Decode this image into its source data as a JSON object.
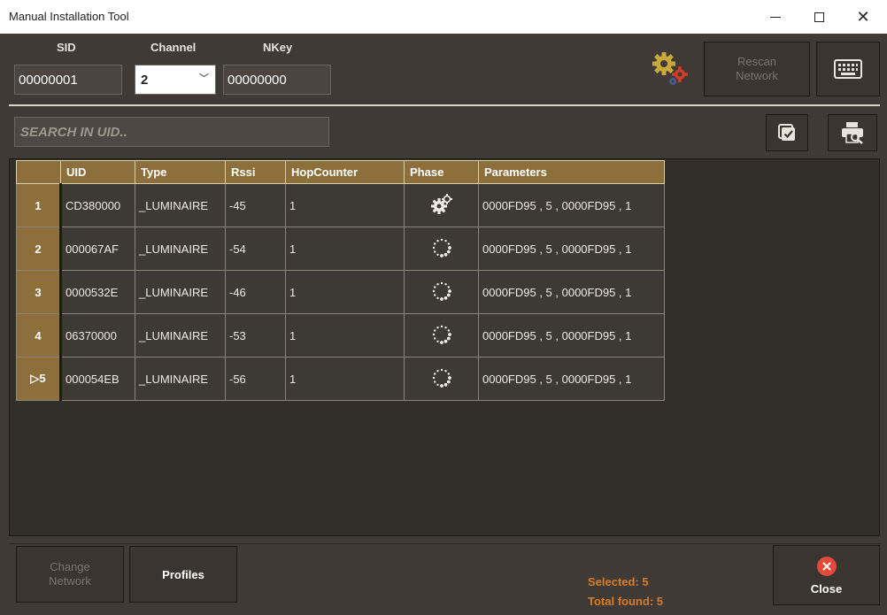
{
  "window": {
    "title": "Manual Installation Tool",
    "minimize_glyph": "",
    "maximize_glyph": "",
    "close_glyph": "✕"
  },
  "header": {
    "sid_label": "SID",
    "sid_value": "00000001",
    "channel_label": "Channel",
    "channel_value": "2",
    "nkey_label": "NKey",
    "nkey_value": "00000000",
    "rescan_line1": "Rescan",
    "rescan_line2": "Network"
  },
  "search": {
    "placeholder": "SEARCH IN UID.."
  },
  "table": {
    "columns": [
      "UID",
      "Type",
      "Rssi",
      "HopCounter",
      "Phase",
      "Parameters"
    ],
    "rows": [
      {
        "num": "1",
        "uid": "CD380000",
        "type": "_LUMINAIRE",
        "rssi": "-45",
        "hop": "1",
        "phase": "gears-icon",
        "params": "0000FD95 , 5 , 0000FD95 , 1"
      },
      {
        "num": "2",
        "uid": "000067AF",
        "type": "_LUMINAIRE",
        "rssi": "-54",
        "hop": "1",
        "phase": "loading-dots-icon",
        "params": "0000FD95 , 5 , 0000FD95 , 1"
      },
      {
        "num": "3",
        "uid": "0000532E",
        "type": "_LUMINAIRE",
        "rssi": "-46",
        "hop": "1",
        "phase": "loading-dots-icon",
        "params": "0000FD95 , 5 , 0000FD95 , 1"
      },
      {
        "num": "4",
        "uid": "06370000",
        "type": "_LUMINAIRE",
        "rssi": "-53",
        "hop": "1",
        "phase": "loading-dots-icon",
        "params": "0000FD95 , 5 , 0000FD95 , 1"
      },
      {
        "num": "▷5",
        "uid": "000054EB",
        "type": "_LUMINAIRE",
        "rssi": "-56",
        "hop": "1",
        "phase": "loading-dots-icon",
        "params": "0000FD95 , 5 , 0000FD95 , 1"
      }
    ]
  },
  "footer": {
    "change_line1": "Change",
    "change_line2": "Network",
    "profiles_label": "Profiles",
    "selected_text": "Selected: 5",
    "total_text": "Total found: 5",
    "close_label": "Close"
  },
  "colors": {
    "background": "#3f3a35",
    "header_gold": "#8c6f3a",
    "accent_orange": "#d97a28",
    "close_red": "#e04a3a"
  }
}
